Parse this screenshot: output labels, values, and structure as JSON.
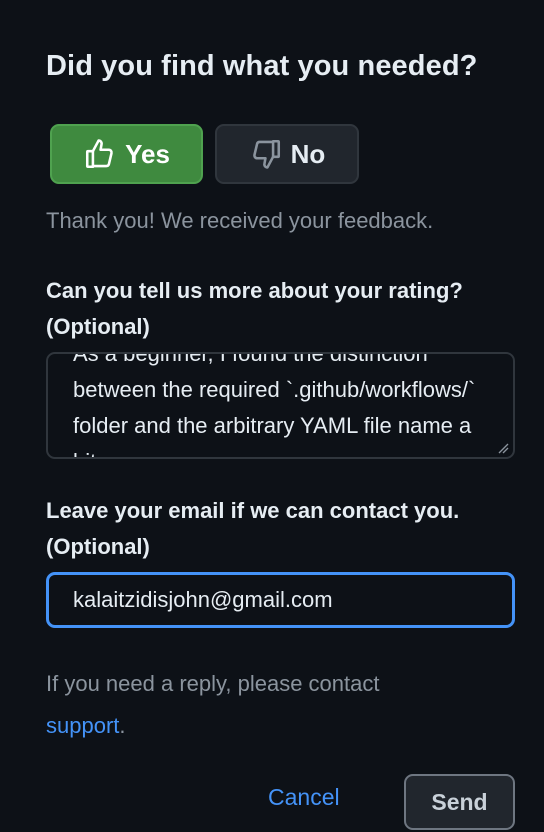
{
  "feedback": {
    "title": "Did you find what you needed?",
    "yes_label": "Yes",
    "no_label": "No",
    "selected": "Yes",
    "thanks_message": "Thank you! We received your feedback."
  },
  "rating_details": {
    "label_line1": "Can you tell us more about your rating?",
    "label_line2": "(Optional)",
    "value": "As a beginner, I found the distinction between the required `.github/workflows/` folder and the arbitrary YAML file name a bit..."
  },
  "email": {
    "label_line1": "Leave your email if we can contact you.",
    "label_line2": "(Optional)",
    "value": "kalaitzidisjohn@gmail.com"
  },
  "reply_note": {
    "text": "If you need a reply, please contact",
    "link_label": "support",
    "suffix": "."
  },
  "actions": {
    "cancel_label": "Cancel",
    "send_label": "Send"
  },
  "colors": {
    "background": "#0d1117",
    "yes_button": "#3f8a3f",
    "link": "#4493f8",
    "focus_border": "#4493f8"
  },
  "icons": {
    "yes": "thumbs-up-icon",
    "no": "thumbs-down-icon",
    "resize": "resize-grip-icon"
  }
}
